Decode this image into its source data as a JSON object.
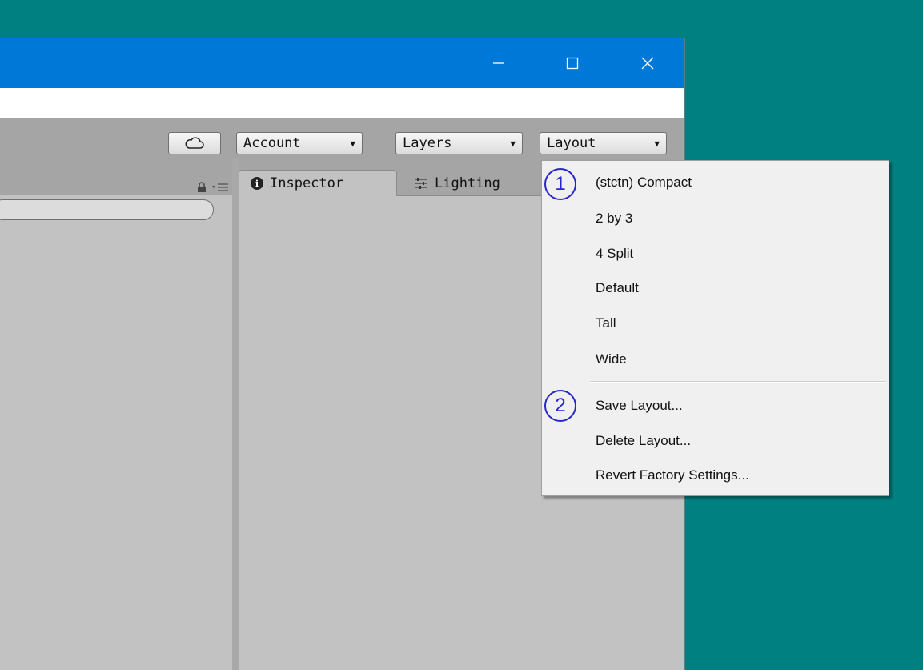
{
  "toolbar": {
    "account_label": "Account",
    "layers_label": "Layers",
    "layout_label": "Layout"
  },
  "panel_tabs": {
    "inspector_label": "Inspector",
    "lighting_label": "Lighting"
  },
  "layout_menu": {
    "items": [
      "(stctn) Compact",
      "2 by 3",
      "4 Split",
      "Default",
      "Tall",
      "Wide",
      "Save Layout...",
      "Delete Layout...",
      "Revert Factory Settings..."
    ]
  },
  "annotations": [
    "1",
    "2"
  ],
  "icons": {
    "window_controls": [
      "minimize-icon",
      "maximize-icon",
      "close-icon"
    ],
    "toolbar": [
      "cloud-icon",
      "dropdown-arrow-icon"
    ],
    "panel": [
      "lock-icon",
      "panel-menu-icon",
      "info-icon",
      "lighting-icon"
    ]
  },
  "colors": {
    "desktop": "#008080",
    "titlebar": "#0078d7",
    "annotation": "#2727c9",
    "menu_bg": "#f0f0f0"
  }
}
